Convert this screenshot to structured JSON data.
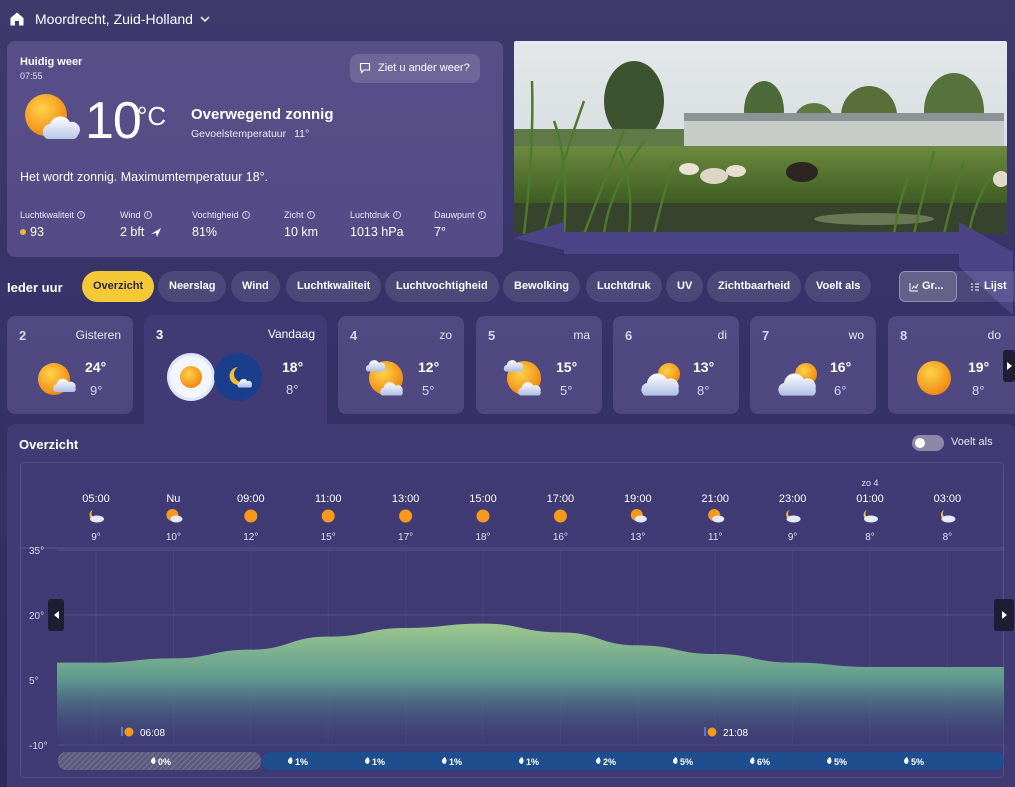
{
  "header": {
    "location": "Moordrecht, Zuid-Holland"
  },
  "current": {
    "label": "Huidig weer",
    "time": "07:55",
    "feedback_label": "Ziet u ander weer?",
    "temperature": "10",
    "unit": "°C",
    "condition": "Overwegend zonnig",
    "feels_label": "Gevoelstemperatuur",
    "feels_value": "11°",
    "summary": "Het wordt zonnig. Maximumtemperatuur 18°.",
    "stats": [
      {
        "label": "Luchtkwaliteit",
        "value": "93"
      },
      {
        "label": "Wind",
        "value": "2 bft"
      },
      {
        "label": "Vochtigheid",
        "value": "81%"
      },
      {
        "label": "Zicht",
        "value": "10 km"
      },
      {
        "label": "Luchtdruk",
        "value": "1013 hPa"
      },
      {
        "label": "Dauwpunt",
        "value": "7°"
      }
    ],
    "accent_aq": "#f2b635"
  },
  "tabs": {
    "title": "Ieder uur",
    "items": [
      "Overzicht",
      "Neerslag",
      "Wind",
      "Luchtkwaliteit",
      "Luchtvochtigheid",
      "Bewolking",
      "Luchtdruk",
      "UV",
      "Zichtbaarheid",
      "Voelt als"
    ],
    "active": "Overzicht",
    "view_graph": "Gr...",
    "view_list": "Lijst"
  },
  "days": [
    {
      "num": "2",
      "label": "Gisteren",
      "hi": "24°",
      "lo": "9°",
      "icon": "partly-sunny-icon"
    },
    {
      "num": "3",
      "label": "Vandaag",
      "hi": "18°",
      "lo": "8°",
      "icon": "sun-and-moon-icon"
    },
    {
      "num": "4",
      "label": "zo",
      "hi": "12°",
      "lo": "5°",
      "icon": "sun-clouds-icon"
    },
    {
      "num": "5",
      "label": "ma",
      "hi": "15°",
      "lo": "5°",
      "icon": "sun-clouds-icon"
    },
    {
      "num": "6",
      "label": "di",
      "hi": "13°",
      "lo": "8°",
      "icon": "cloudy-sun-icon"
    },
    {
      "num": "7",
      "label": "wo",
      "hi": "16°",
      "lo": "6°",
      "icon": "cloudy-sun-icon"
    },
    {
      "num": "8",
      "label": "do",
      "hi": "19°",
      "lo": "8°",
      "icon": "sun-icon"
    }
  ],
  "overview": {
    "title": "Overzicht",
    "feels_toggle_label": "Voelt als",
    "day_marker": "zo 4",
    "hours": [
      {
        "time": "05:00",
        "temp": "9°",
        "icon": "moon-cloud-icon"
      },
      {
        "time": "Nu",
        "temp": "10°",
        "icon": "sun-cloud-icon"
      },
      {
        "time": "09:00",
        "temp": "12°",
        "icon": "sun-icon"
      },
      {
        "time": "11:00",
        "temp": "15°",
        "icon": "sun-icon"
      },
      {
        "time": "13:00",
        "temp": "17°",
        "icon": "sun-icon"
      },
      {
        "time": "15:00",
        "temp": "18°",
        "icon": "sun-icon"
      },
      {
        "time": "17:00",
        "temp": "16°",
        "icon": "sun-icon"
      },
      {
        "time": "19:00",
        "temp": "13°",
        "icon": "sun-cloud-icon"
      },
      {
        "time": "21:00",
        "temp": "11°",
        "icon": "sun-cloud-icon"
      },
      {
        "time": "23:00",
        "temp": "9°",
        "icon": "moon-cloud-icon"
      },
      {
        "time": "01:00",
        "temp": "8°",
        "icon": "moon-cloud-icon"
      },
      {
        "time": "03:00",
        "temp": "8°",
        "icon": "moon-cloud-icon"
      }
    ],
    "yticks": [
      "35°",
      "20°",
      "5°",
      "-10°"
    ],
    "sunrise": "06:08",
    "sunset": "21:08",
    "precip": [
      "0%",
      "1%",
      "1%",
      "1%",
      "1%",
      "2%",
      "5%",
      "6%",
      "5%",
      "5%"
    ]
  },
  "chart_data": {
    "type": "area",
    "x": [
      "05:00",
      "Nu",
      "09:00",
      "11:00",
      "13:00",
      "15:00",
      "17:00",
      "19:00",
      "21:00",
      "23:00",
      "01:00",
      "03:00"
    ],
    "series": [
      {
        "values": [
          9,
          10,
          12,
          15,
          17,
          18,
          16,
          13,
          11,
          9,
          8,
          8
        ]
      }
    ],
    "ylim": [
      -10,
      35
    ],
    "yticks": [
      35,
      20,
      5,
      -10
    ],
    "grid": true
  }
}
